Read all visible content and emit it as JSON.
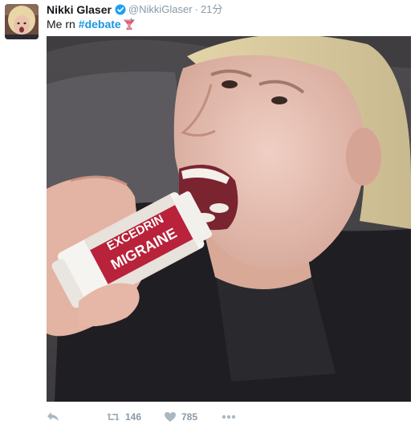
{
  "tweet": {
    "author_name": "Nikki Glaser",
    "handle": "@NikkiGlaser",
    "separator": "·",
    "time": "21分",
    "text": "Me rn",
    "hashtag": "#debate"
  },
  "actions": {
    "retweet_count": "146",
    "like_count": "785"
  },
  "photo": {
    "bottle_brand": "EXCEDRIN",
    "bottle_variant": "MIGRAINE"
  },
  "icons": {
    "verified": "verified-badge-icon",
    "emoji": "tropical-drink-icon",
    "reply": "reply-icon",
    "retweet": "retweet-icon",
    "like": "heart-icon",
    "more": "more-dots-icon"
  },
  "colors": {
    "link": "#1b95e0",
    "muted": "#8899a6",
    "text": "#14171a"
  }
}
